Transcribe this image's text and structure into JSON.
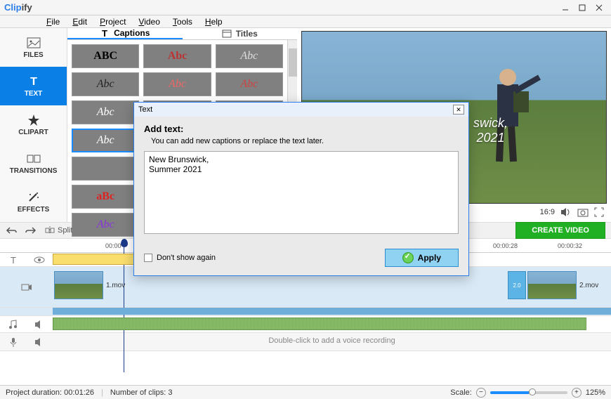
{
  "app": {
    "name_prefix": "Clip",
    "name_suffix": "ify"
  },
  "menu": [
    "File",
    "Edit",
    "Project",
    "Video",
    "Tools",
    "Help"
  ],
  "sidebar": [
    {
      "label": "FILES",
      "icon": "image-icon"
    },
    {
      "label": "TEXT",
      "icon": "text-icon",
      "active": true
    },
    {
      "label": "CLIPART",
      "icon": "star-icon"
    },
    {
      "label": "TRANSITIONS",
      "icon": "transitions-icon"
    },
    {
      "label": "EFFECTS",
      "icon": "wand-icon"
    }
  ],
  "caption_tabs": {
    "captions": "Captions",
    "titles": "Titles"
  },
  "preview": {
    "caption_line1": "swick,",
    "caption_line2": "2021",
    "aspect": "16:9"
  },
  "toolbar": {
    "split": "Split",
    "create": "CREATE VIDEO"
  },
  "ruler": [
    "00:00",
    "00:00:28",
    "00:00:32"
  ],
  "clips": {
    "clip1": "1.mov",
    "clip2": "2.mov",
    "trans": "2.0"
  },
  "voice_hint": "Double-click to add a voice recording",
  "status": {
    "duration_label": "Project duration:",
    "duration_value": "00:01:26",
    "clips_label": "Number of clips:",
    "clips_value": "3",
    "scale_label": "Scale:",
    "scale_value": "125%"
  },
  "modal": {
    "title": "Text",
    "heading": "Add text:",
    "sub": "You can add new captions or replace the text later.",
    "text": "New Brunswick,\nSummer 2021",
    "dont_show": "Don't show again",
    "apply": "Apply"
  }
}
